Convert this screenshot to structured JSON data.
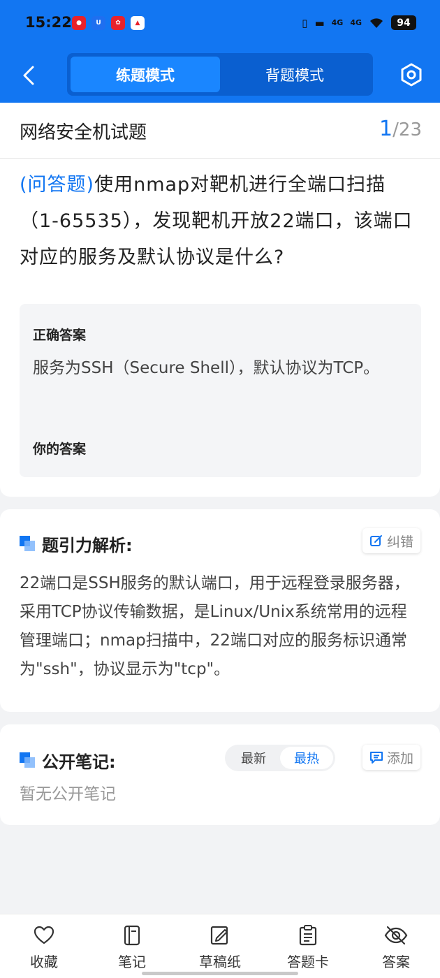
{
  "status_bar": {
    "time": "15:22",
    "network_1": "4G",
    "network_2": "4G",
    "battery": "94"
  },
  "header": {
    "tabs": [
      {
        "label": "练题模式",
        "active": true
      },
      {
        "label": "背题模式",
        "active": false
      }
    ],
    "accent_color": "#1276f2"
  },
  "title_bar": {
    "title": "网络安全机试题",
    "current": "1",
    "separator": "/",
    "total": "23"
  },
  "question": {
    "type": "(问答题)",
    "text": "使用nmap对靶机进行全端口扫描（1-65535），发现靶机开放22端口，该端口对应的服务及默认协议是什么?"
  },
  "answer": {
    "correct_label": "正确答案",
    "correct_text": "服务为SSH（Secure Shell），默认协议为TCP。",
    "yours_label": "你的答案"
  },
  "analysis": {
    "title": "题引力解析:",
    "report_label": "纠错",
    "text": "22端口是SSH服务的默认端口，用于远程登录服务器，采用TCP协议传输数据，是Linux/Unix系统常用的远程管理端口；nmap扫描中，22端口对应的服务标识通常为\"ssh\"，协议显示为\"tcp\"。"
  },
  "notes": {
    "title": "公开笔记:",
    "sort_options": [
      {
        "label": "最新",
        "active": false
      },
      {
        "label": "最热",
        "active": true
      }
    ],
    "add_label": "添加",
    "empty_text": "暂无公开笔记"
  },
  "bottom_bar": {
    "items": [
      {
        "label": "收藏",
        "icon": "heart-icon"
      },
      {
        "label": "笔记",
        "icon": "notebook-icon"
      },
      {
        "label": "草稿纸",
        "icon": "draft-paper-icon"
      },
      {
        "label": "答题卡",
        "icon": "answer-sheet-icon"
      },
      {
        "label": "答案",
        "icon": "eye-hidden-icon"
      }
    ]
  }
}
